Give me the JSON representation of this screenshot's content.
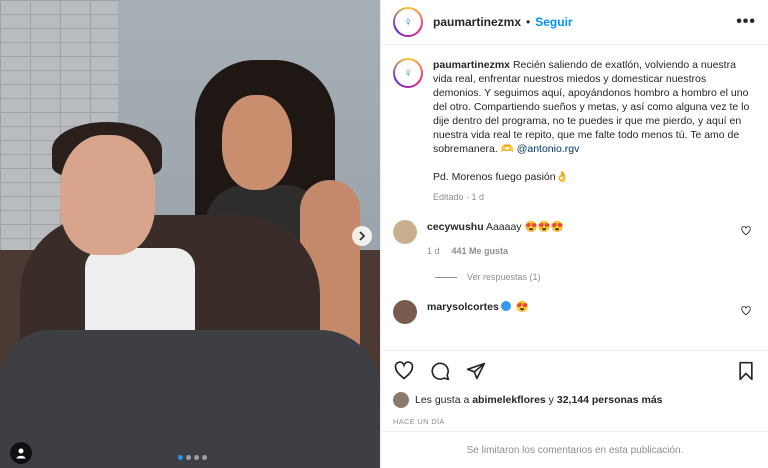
{
  "post": {
    "username": "paumartinezmx",
    "follow_label": "Seguir",
    "separator": "•",
    "more_label": "•••"
  },
  "caption": {
    "username": "paumartinezmx",
    "text": " Recién saliendo de exatlón, volviendo a nuestra vida real, enfrentar nuestros miedos y domesticar nuestros demonios. Y seguimos aquí, apoyándonos hombro a hombro el uno del otro. Compartiendo sueños y metas, y así como alguna vez te lo dije dentro del programa, no te puedes ir que me pierdo, y aquí en nuestra vida real te repito, que me falte todo menos tú. Te amo de sobremanera. 🫶 ",
    "mention": "@antonio.rgv",
    "ps": "Pd. Morenos fuego pasión👌",
    "edited": "Editado · 1 d"
  },
  "comments": [
    {
      "username": "cecywushu",
      "text": " Aaaaay 😍😍😍",
      "time": "1 d",
      "likes": "441 Me gusta",
      "avatar_color": "#c9b08c"
    },
    {
      "username": "marysolcortes",
      "text": " 😍",
      "avatar_color": "#7a5b4f"
    }
  ],
  "replies_label": "Ver respuestas (1)",
  "likes_line": {
    "prefix": "Les gusta a ",
    "user": "abimelekflores",
    "middle": " y ",
    "count": "32,144 personas más"
  },
  "time_label": "HACE UN DÍA",
  "comments_disabled": "Se limitaron los comentarios en esta publicación.",
  "icons": {
    "like": "heart-icon",
    "comment": "comment-icon",
    "share": "share-icon",
    "save": "bookmark-icon",
    "next": "chevron-right-icon",
    "tag": "user-tag-icon"
  },
  "colors": {
    "accent": "#0095f6",
    "muted": "#8e8e8e",
    "carousel_active": "#2196f3"
  }
}
